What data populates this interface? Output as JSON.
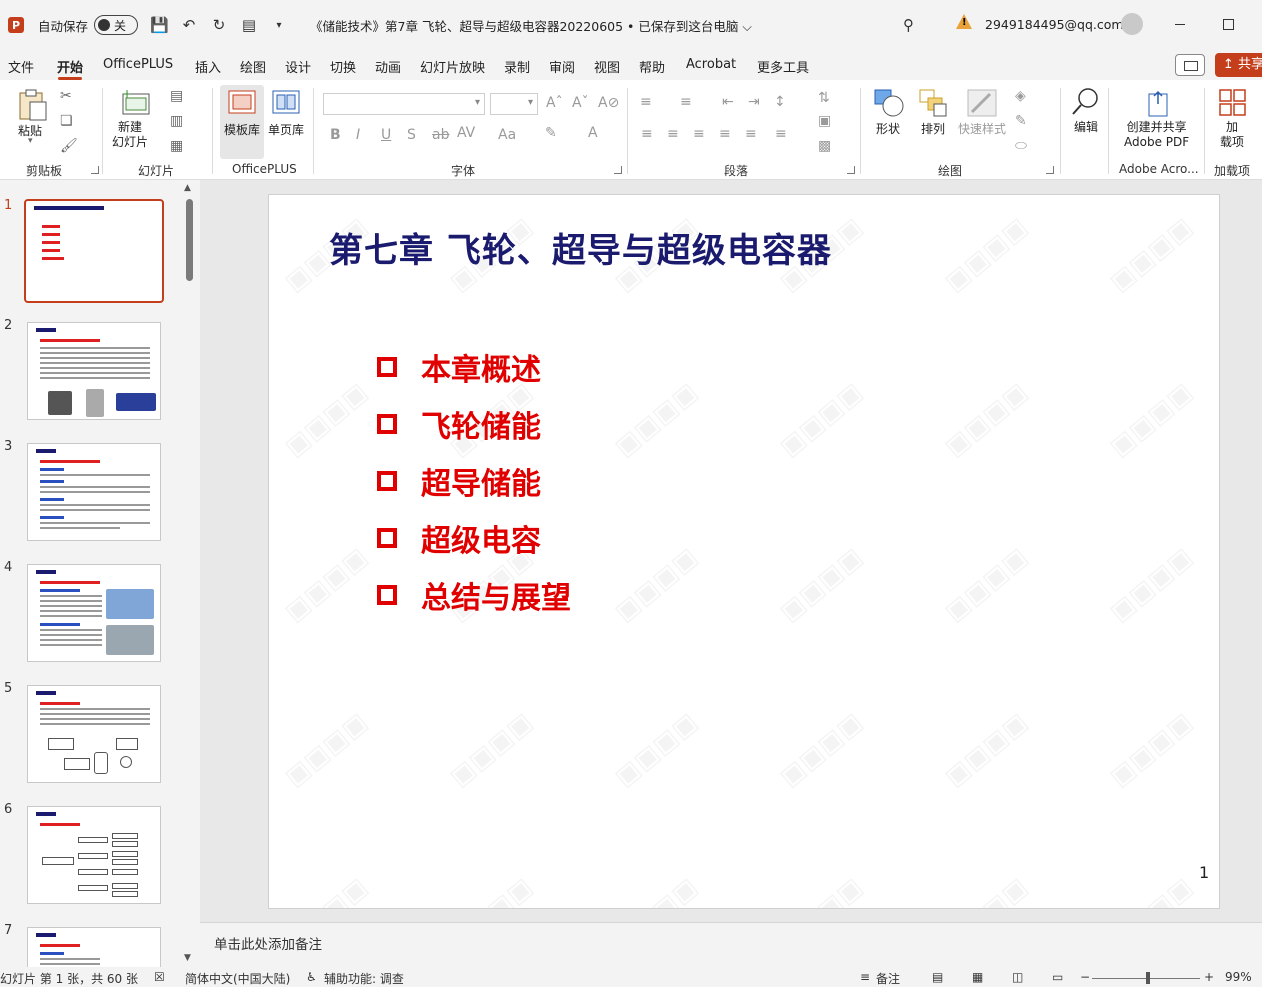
{
  "titlebar": {
    "autosave_label": "自动保存",
    "autosave_state": "关",
    "doc_title": "《储能技术》第7章 飞轮、超导与超级电容器20220605 • 已保存到这台电脑 ⌵",
    "account_email": "2949184495@qq.com"
  },
  "menu": {
    "tabs": [
      "文件",
      "开始",
      "OfficePLUS",
      "插入",
      "绘图",
      "设计",
      "切换",
      "动画",
      "幻灯片放映",
      "录制",
      "审阅",
      "视图",
      "帮助",
      "Acrobat",
      "更多工具"
    ],
    "active": "开始",
    "share_label": "共享"
  },
  "ribbon": {
    "clipboard": {
      "paste": "粘贴",
      "group": "剪贴板"
    },
    "slides": {
      "new_slide": "新建\n幻灯片",
      "group": "幻灯片"
    },
    "officeplus": {
      "template": "模板库",
      "single": "单页库",
      "group": "OfficePLUS"
    },
    "font": {
      "group": "字体"
    },
    "paragraph": {
      "group": "段落"
    },
    "drawing": {
      "shapes": "形状",
      "arrange": "排列",
      "quick_styles": "快速样式",
      "group": "绘图"
    },
    "editing": {
      "edit": "编辑"
    },
    "adobe": {
      "create_share": "创建并共享\nAdobe PDF",
      "group": "Adobe Acro..."
    },
    "addins": {
      "addins": "加\n载项",
      "group": "加载项"
    }
  },
  "thumbnails": {
    "numbers": [
      "1",
      "2",
      "3",
      "4",
      "5",
      "6",
      "7"
    ],
    "active": 1
  },
  "slide": {
    "title": "第七章  飞轮、超导与超级电容器",
    "bullets": [
      "本章概述",
      "飞轮储能",
      "超导储能",
      "超级电容",
      "总结与展望"
    ],
    "page_number": "1",
    "colors": {
      "title": "#1a1a6e",
      "bullet": "#e00000"
    }
  },
  "notes": {
    "placeholder": "单击此处添加备注"
  },
  "statusbar": {
    "slide_info": "幻灯片 第 1 张，共 60 张",
    "language": "简体中文(中国大陆)",
    "accessibility": "辅助功能: 调查",
    "notes_label": "备注",
    "zoom_percent": "99%",
    "zoom_fraction": 0.99
  }
}
